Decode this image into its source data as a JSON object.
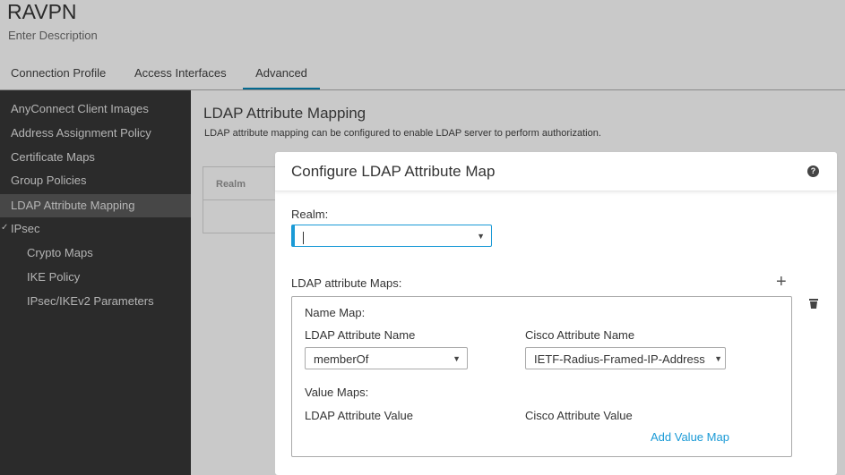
{
  "header": {
    "title": "RAVPN",
    "description": "Enter Description"
  },
  "tabs": [
    {
      "label": "Connection Profile"
    },
    {
      "label": "Access Interfaces"
    },
    {
      "label": "Advanced",
      "active": true
    }
  ],
  "sidebar": {
    "items": [
      {
        "label": "AnyConnect Client Images"
      },
      {
        "label": "Address Assignment Policy"
      },
      {
        "label": "Certificate Maps"
      },
      {
        "label": "Group Policies"
      },
      {
        "label": "LDAP Attribute Mapping",
        "selected": true
      },
      {
        "label": "IPsec",
        "expanded": true
      },
      {
        "label": "Crypto Maps"
      },
      {
        "label": "IKE Policy"
      },
      {
        "label": "IPsec/IKEv2 Parameters"
      }
    ]
  },
  "main": {
    "title": "LDAP Attribute Mapping",
    "description": "LDAP attribute mapping can be configured to enable LDAP server to perform authorization.",
    "table_header": "Realm"
  },
  "modal": {
    "title": "Configure LDAP Attribute Map",
    "realm_label": "Realm:",
    "realm_value": "",
    "maps_label": "LDAP attribute Maps:",
    "name_map_label": "Name Map:",
    "ldap_attr_name_label": "LDAP Attribute Name",
    "cisco_attr_name_label": "Cisco Attribute Name",
    "ldap_attr_name_value": "memberOf",
    "cisco_attr_name_value": "IETF-Radius-Framed-IP-Address",
    "value_maps_label": "Value Maps:",
    "ldap_attr_value_label": "LDAP Attribute Value",
    "cisco_attr_value_label": "Cisco Attribute Value",
    "add_value_map": "Add Value Map"
  },
  "colors": {
    "accent": "#1a9ad6",
    "tab_underline": "#04698f",
    "sidebar": "#2b2b2b"
  }
}
